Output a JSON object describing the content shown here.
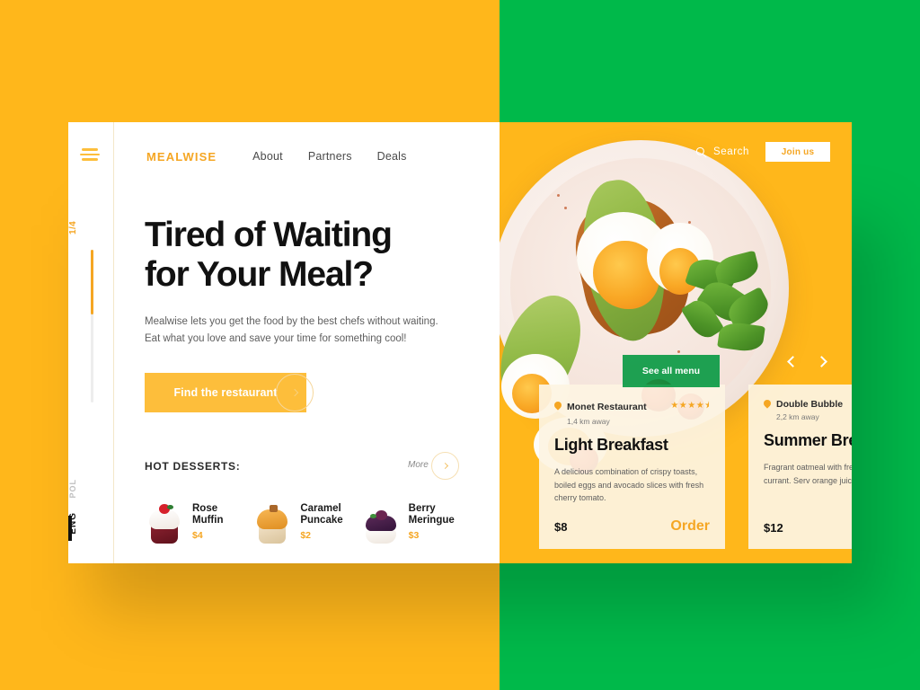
{
  "theme": {
    "orange": "#FFB71B",
    "green": "#00B94A",
    "accent": "#F5A623",
    "card_bg": "#FDF4E2"
  },
  "sidebar": {
    "step": "1/4",
    "lang_inactive": "POL",
    "lang_active": "ENG"
  },
  "nav": {
    "menu_icon": "hamburger-icon",
    "brand": "MEALWISE",
    "links": [
      {
        "label": "About"
      },
      {
        "label": "Partners"
      },
      {
        "label": "Deals"
      }
    ]
  },
  "hero": {
    "headline_line1": "Tired of Waiting",
    "headline_line2": "for Your Meal?",
    "subtext_line1": "Mealwise lets you get the food by the best chefs without waiting.",
    "subtext_line2": "Eat what you love and save your time for something cool!",
    "cta_label": "Find the restaurant",
    "cta_arrow_icon": "chevron-right-icon"
  },
  "desserts": {
    "title": "HOT DESSERTS:",
    "more_label": "More",
    "more_arrow_icon": "chevron-right-icon",
    "items": [
      {
        "name_line1": "Rose",
        "name_line2": "Muffin",
        "price": "$4",
        "art": "rose-muffin"
      },
      {
        "name_line1": "Caramel",
        "name_line2": "Puncake",
        "price": "$2",
        "art": "caramel-puncake"
      },
      {
        "name_line1": "Berry",
        "name_line2": "Meringue",
        "price": "$3",
        "art": "berry-meringue"
      }
    ]
  },
  "hero_right": {
    "search_label": "Search",
    "search_icon": "search-icon",
    "join_label": "Join us",
    "see_menu_label": "See all menu",
    "prev_icon": "chevron-left-icon",
    "next_icon": "chevron-right-icon",
    "photo_alt": "breakfast plate with avocado toast poached eggs greens and cherry tomatoes"
  },
  "cards": [
    {
      "restaurant": "Monet Restaurant",
      "distance": "1,4 km away",
      "stars": "★★★★⯨",
      "title": "Light Breakfast",
      "description": "A delicious combination of crispy toasts, boiled eggs and avocado slices with fresh cherry tomato.",
      "price": "$8",
      "order_label": "Order"
    },
    {
      "restaurant": "Double Bubble",
      "distance": "2,2 km away",
      "stars": "",
      "title": "Summer Bre",
      "description": "Fragrant oatmeal with fresh strawberry and currant. Serv orange juice.",
      "price": "$12",
      "order_label": ""
    }
  ]
}
